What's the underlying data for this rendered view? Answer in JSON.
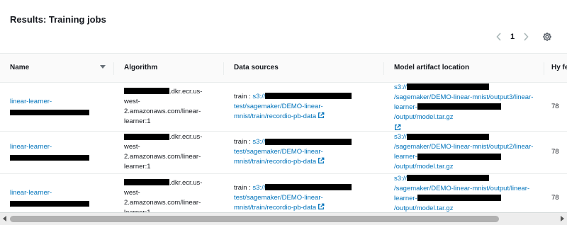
{
  "panel": {
    "title": "Results: Training jobs",
    "pagination": {
      "prev_icon": "chevron-left",
      "current_page": "1",
      "next_icon": "chevron-right"
    },
    "settings_icon": "gear"
  },
  "table": {
    "columns": {
      "name": "Name",
      "algorithm": "Algorithm",
      "data_sources": "Data sources",
      "model_artifact": "Model artifact location",
      "hyper": "Hy fe"
    },
    "rows": [
      {
        "name": "linear-learner-",
        "algo_suffix": ".dkr.ecr.us-west-2.amazonaws.com/linear-learner:1",
        "ds_prefix": "train : ",
        "ds_s3": "s3://",
        "ds_path": "test/sagemaker/DEMO-linear-mnist/train/recordio-pb-data",
        "model_s3": "s3://",
        "model_mid": "/sagemaker/DEMO-linear-mnist/output3/linear-learner-",
        "model_end": "/output/model.tar.gz",
        "hyper": "78"
      },
      {
        "name": "linear-learner-",
        "algo_suffix": ".dkr.ecr.us-west-2.amazonaws.com/linear-learner:1",
        "ds_prefix": "train : ",
        "ds_s3": "s3://",
        "ds_path": "test/sagemaker/DEMO-linear-mnist/train/recordio-pb-data",
        "model_s3": "s3://",
        "model_mid": "/sagemaker/DEMO-linear-mnist/output2/linear-learner-",
        "model_end": "/output/model.tar.gz",
        "hyper": "78"
      },
      {
        "name": "linear-learner-",
        "algo_suffix": ".dkr.ecr.us-west-2.amazonaws.com/linear-learner:1",
        "ds_prefix": "train : ",
        "ds_s3": "s3://",
        "ds_path": "test/sagemaker/DEMO-linear-mnist/train/recordio-pb-data",
        "model_s3": "s3://",
        "model_mid": "/sagemaker/DEMO-linear-mnist/output/linear-learner-",
        "model_end": "/output/model.tar.gz",
        "hyper": "78"
      }
    ]
  },
  "colors": {
    "link": "#0073bb",
    "text": "#16191f",
    "border": "#eaeded",
    "redaction": "#000000"
  }
}
